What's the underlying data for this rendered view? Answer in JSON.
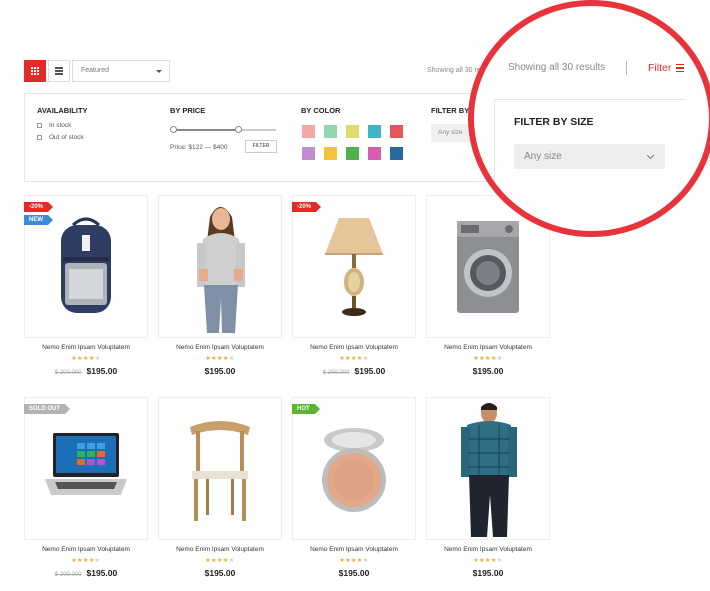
{
  "toolbar": {
    "sort_value": "Featured",
    "results_text": "Showing all 30 results"
  },
  "filters": {
    "availability": {
      "title": "AVAILABILITY",
      "options": [
        "In stock",
        "Out of stock"
      ]
    },
    "price": {
      "title": "BY PRICE",
      "range_text": "Price: $122 — $400",
      "button_label": "FILTER"
    },
    "color": {
      "title": "BY COLOR",
      "swatches": [
        "#f4a7a7",
        "#93d6b2",
        "#e0dc6c",
        "#3fb6c8",
        "#e8545a",
        "#c38bd0",
        "#f2c23c",
        "#4fb148",
        "#d65fb1",
        "#256b9e"
      ]
    },
    "size": {
      "title": "FILTER BY SIZE",
      "title_truncated": "FILTER BY SI",
      "placeholder": "Any size"
    }
  },
  "zoom": {
    "results_text": "Showing all 30 results",
    "filter_label": "Filter",
    "size_title": "FILTER BY SIZE",
    "size_value": "Any size"
  },
  "colors": {
    "accent": "#e02b27",
    "circle": "#e8333b"
  },
  "products": [
    {
      "name": "Nemo Enim Ipsam Voluptatem",
      "rating": 4,
      "old_price": "$ 200.000",
      "price": "$195.00",
      "badges": [
        {
          "text": "-20%",
          "type": "sale"
        },
        {
          "text": "NEW",
          "type": "new"
        }
      ],
      "image": "backpack"
    },
    {
      "name": "Nemo Enim Ipsam Voluptatem",
      "rating": 4,
      "old_price": "",
      "price": "$195.00",
      "badges": [],
      "image": "woman"
    },
    {
      "name": "Nemo Enim Ipsam Voluptatem",
      "rating": 4,
      "old_price": "$ 200.000",
      "price": "$195.00",
      "badges": [
        {
          "text": "-20%",
          "type": "sale"
        }
      ],
      "image": "lamp"
    },
    {
      "name": "Nemo Enim Ipsam Voluptatem",
      "rating": 4,
      "old_price": "",
      "price": "$195.00",
      "badges": [],
      "image": "washer"
    },
    {
      "name": "Nemo Enim Ipsam Voluptatem",
      "rating": 4,
      "old_price": "$ 200.000",
      "price": "$195.00",
      "badges": [
        {
          "text": "SOLD OUT",
          "type": "soldout"
        }
      ],
      "image": "laptop"
    },
    {
      "name": "Nemo Enim Ipsam Voluptatem",
      "rating": 4,
      "old_price": "",
      "price": "$195.00",
      "badges": [],
      "image": "chair"
    },
    {
      "name": "Nemo Enim Ipsam Voluptatem",
      "rating": 4,
      "old_price": "",
      "price": "$195.00",
      "badges": [
        {
          "text": "HOT",
          "type": "hot"
        }
      ],
      "image": "compact"
    },
    {
      "name": "Nemo Enim Ipsam Voluptatem",
      "rating": 4,
      "old_price": "",
      "price": "$195.00",
      "badges": [],
      "image": "man"
    }
  ]
}
